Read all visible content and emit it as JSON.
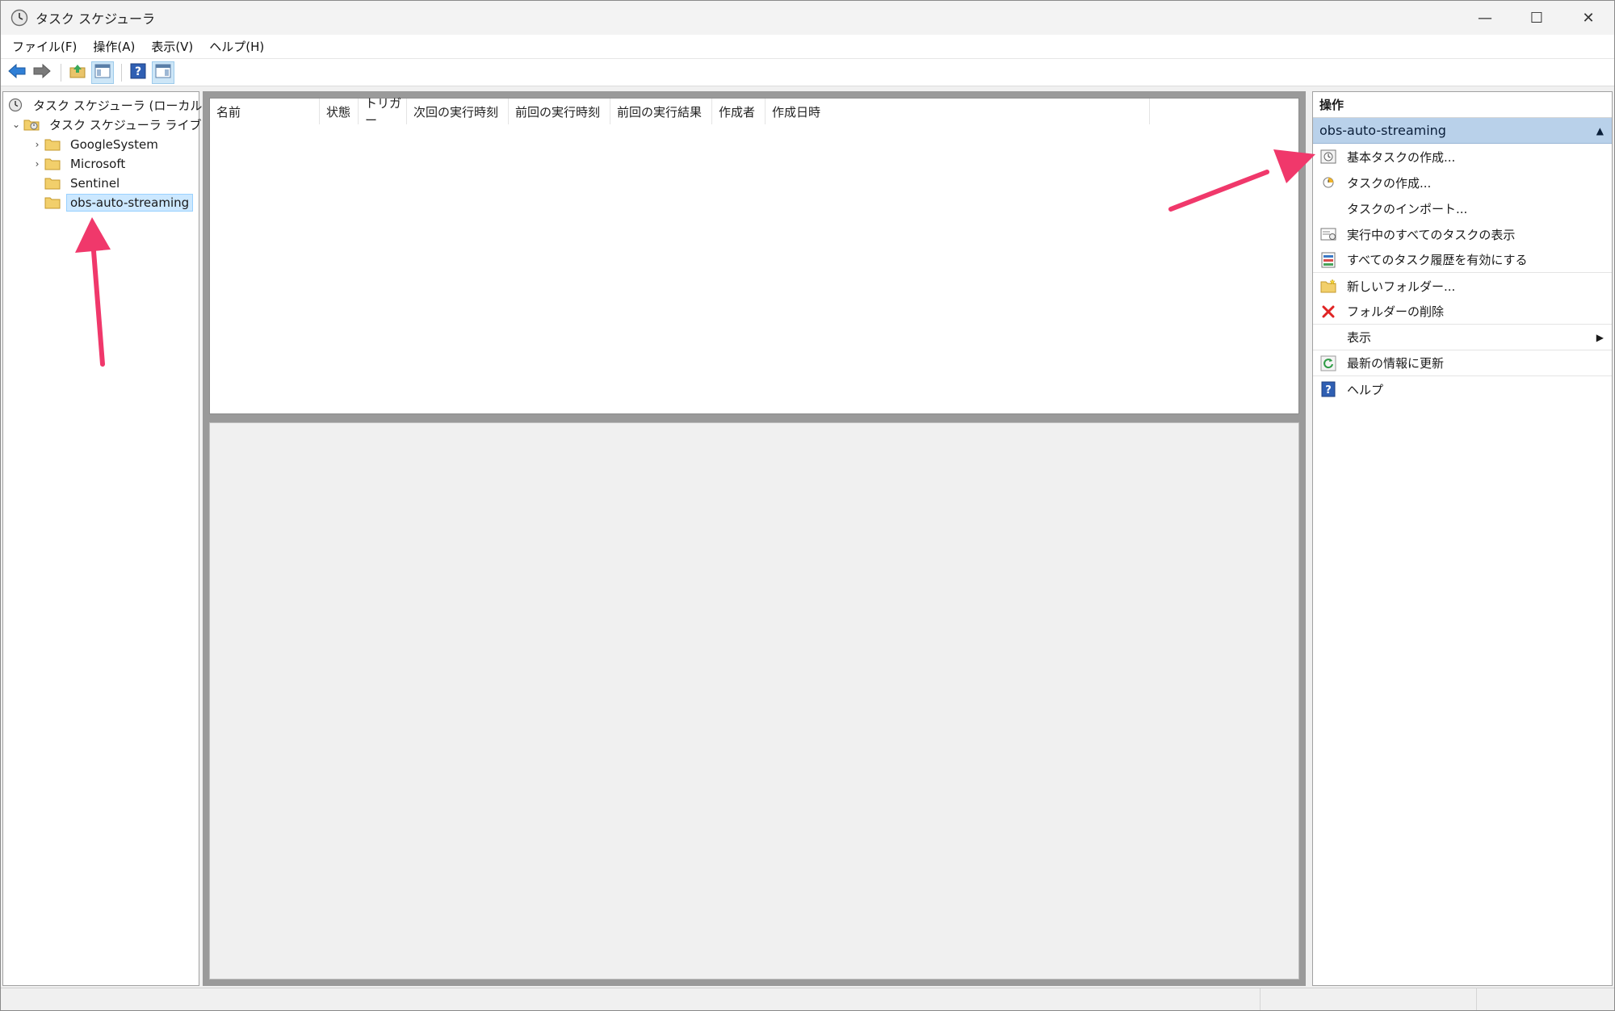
{
  "window": {
    "title": "タスク スケジューラ",
    "controls": {
      "minimize": "—",
      "maximize": "☐",
      "close": "✕"
    }
  },
  "menubar": {
    "items": [
      "ファイル(F)",
      "操作(A)",
      "表示(V)",
      "ヘルプ(H)"
    ]
  },
  "toolbar": {
    "buttons": [
      "back-icon",
      "forward-icon",
      "up-folder-icon",
      "show-hide-tree-icon",
      "help-icon",
      "show-hide-action-pane-icon"
    ]
  },
  "tree": {
    "root": "タスク スケジューラ (ローカル)",
    "library": "タスク スケジューラ ライブラリ",
    "children": [
      "GoogleSystem",
      "Microsoft",
      "Sentinel",
      "obs-auto-streaming"
    ],
    "selected": "obs-auto-streaming"
  },
  "task_list": {
    "columns": [
      "名前",
      "状態",
      "トリガー",
      "次回の実行時刻",
      "前回の実行時刻",
      "前回の実行結果",
      "作成者",
      "作成日時"
    ]
  },
  "actions": {
    "header": "操作",
    "group_title": "obs-auto-streaming",
    "items": [
      "基本タスクの作成...",
      "タスクの作成...",
      "タスクのインポート...",
      "実行中のすべてのタスクの表示",
      "すべてのタスク履歴を有効にする",
      "新しいフォルダー...",
      "フォルダーの削除",
      "表示",
      "最新の情報に更新",
      "ヘルプ"
    ]
  },
  "colors": {
    "annotation_arrow": "#f0386b",
    "selection": "#cce8ff",
    "group_header": "#b9d1ea"
  }
}
